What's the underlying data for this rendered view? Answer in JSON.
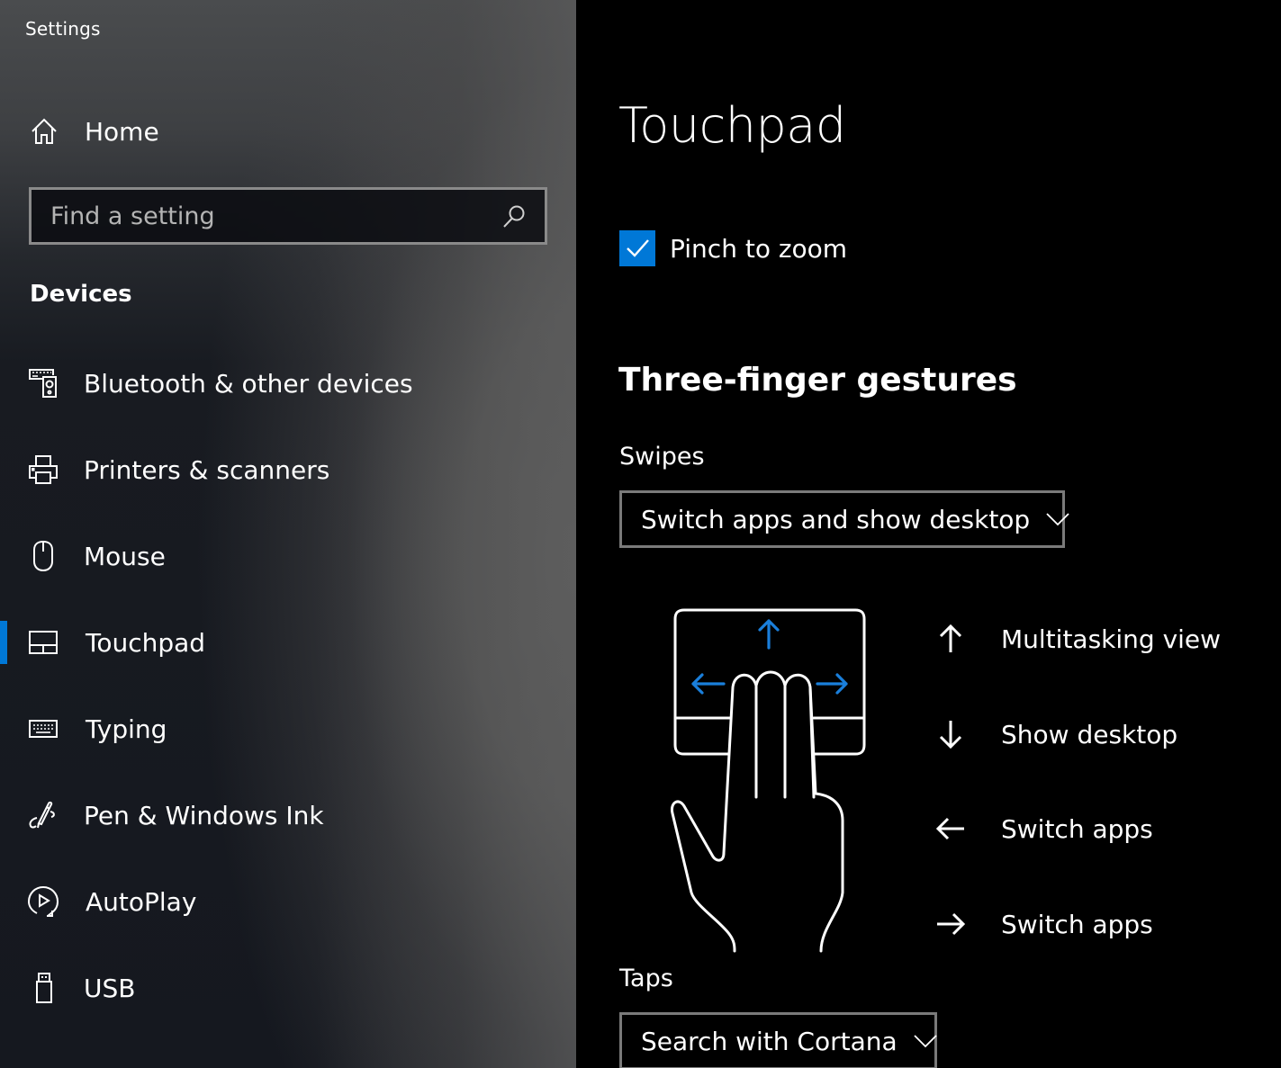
{
  "window": {
    "title": "Settings"
  },
  "sidebar": {
    "home_label": "Home",
    "search": {
      "placeholder": "Find a setting",
      "value": ""
    },
    "section_title": "Devices",
    "items": [
      {
        "label": "Bluetooth & other devices",
        "icon": "bluetooth-devices-icon",
        "selected": false
      },
      {
        "label": "Printers & scanners",
        "icon": "printer-icon",
        "selected": false
      },
      {
        "label": "Mouse",
        "icon": "mouse-icon",
        "selected": false
      },
      {
        "label": "Touchpad",
        "icon": "touchpad-icon",
        "selected": true
      },
      {
        "label": "Typing",
        "icon": "keyboard-icon",
        "selected": false
      },
      {
        "label": "Pen & Windows Ink",
        "icon": "pen-icon",
        "selected": false
      },
      {
        "label": "AutoPlay",
        "icon": "autoplay-icon",
        "selected": false
      },
      {
        "label": "USB",
        "icon": "usb-icon",
        "selected": false
      }
    ]
  },
  "main": {
    "title": "Touchpad",
    "pinch_to_zoom": {
      "label": "Pinch to zoom",
      "checked": true
    },
    "three_finger": {
      "heading": "Three-finger gestures",
      "swipes": {
        "label": "Swipes",
        "selected": "Switch apps and show desktop"
      },
      "gestures": [
        {
          "direction": "up",
          "arrow": "↑",
          "action": "Multitasking view"
        },
        {
          "direction": "down",
          "arrow": "↓",
          "action": "Show desktop"
        },
        {
          "direction": "left",
          "arrow": "←",
          "action": "Switch apps"
        },
        {
          "direction": "right",
          "arrow": "→",
          "action": "Switch apps"
        }
      ],
      "taps": {
        "label": "Taps",
        "selected": "Search with Cortana"
      }
    }
  },
  "colors": {
    "accent": "#0078d7",
    "content_background": "#000000",
    "text": "#ffffff",
    "dropdown_border": "#7a7a7a"
  }
}
